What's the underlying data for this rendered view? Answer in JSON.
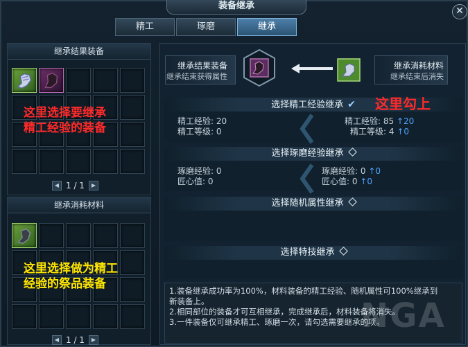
{
  "window": {
    "title": "装备继承",
    "close": "✕"
  },
  "tabs": [
    {
      "label": "精工",
      "active": false
    },
    {
      "label": "琢磨",
      "active": false
    },
    {
      "label": "继承",
      "active": true
    }
  ],
  "left": {
    "result_panel": {
      "title": "继承结果装备",
      "pager": "1 / 1",
      "prev": "◀",
      "next": "▶"
    },
    "material_panel": {
      "title": "继承消耗材料",
      "pager": "1 / 1",
      "prev": "◀",
      "next": "▶"
    }
  },
  "annotations": {
    "result_line1": "这里选择要继承",
    "result_line2": "精工经验的装备",
    "material_line1": "这里选择做为精工",
    "material_line2": "经验的祭品装备",
    "check_note": "这里勾上"
  },
  "top": {
    "result_label": "继承结果装备",
    "result_sub": "继承结束获得属性",
    "material_label": "继承消耗材料",
    "material_sub": "继承结束后消失"
  },
  "sections": {
    "refine": {
      "title": "选择精工经验继承",
      "checked": true,
      "left_exp_label": "精工经验:",
      "left_exp_value": "20",
      "left_level_label": "精工等级:",
      "left_level_value": "0",
      "right_exp_label": "精工经验:",
      "right_exp_value": "85",
      "right_exp_up": "↑20",
      "right_level_label": "精工等级:",
      "right_level_value": "4",
      "right_level_up": "↑0"
    },
    "polish": {
      "title": "选择琢磨经验继承",
      "left_exp_label": "琢磨经验:",
      "left_exp_value": "0",
      "left_craft_label": "匠心值:",
      "left_craft_value": "0",
      "right_exp_label": "琢磨经验:",
      "right_exp_value": "0",
      "right_exp_up": "↑0",
      "right_craft_label": "匠心值:",
      "right_craft_value": "0",
      "right_craft_up": "↑0"
    },
    "random": {
      "title": "选择随机属性继承"
    },
    "skill": {
      "title": "选择特技继承"
    }
  },
  "notes": {
    "line1": "1.装备继承成功率为100%，材料装备的精工经验、随机属性可100%继承到",
    "line2": "新装备上。",
    "line3": "2.相同部位的装备才可互相继承，完成继承后，材料装备将消失。",
    "line4": "3.一件装备仅可继承精工、琢磨一次，请勾选需要继承的项。"
  },
  "watermark": "NGA",
  "colors": {
    "annotation_red": "#ff2a2a",
    "annotation_yellow": "#ffe600",
    "tab_active": "#4d7fa8",
    "stat_up": "#4fa3ff"
  }
}
